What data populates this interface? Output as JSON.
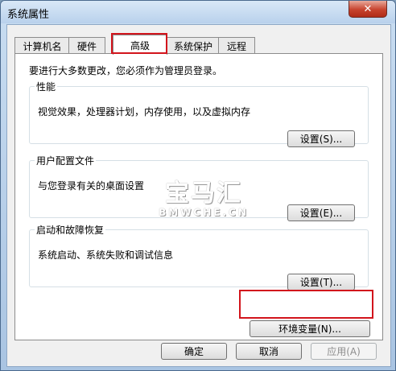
{
  "window": {
    "title": "系统属性",
    "close_glyph": "✕"
  },
  "tabs": [
    {
      "label": "计算机名"
    },
    {
      "label": "硬件"
    },
    {
      "label": "高级"
    },
    {
      "label": "系统保护"
    },
    {
      "label": "远程"
    }
  ],
  "advanced": {
    "admin_note": "要进行大多数更改，您必须作为管理员登录。",
    "performance": {
      "title": "性能",
      "description": "视觉效果，处理器计划，内存使用，以及虚拟内存",
      "button": "设置(S)..."
    },
    "user_profiles": {
      "title": "用户配置文件",
      "description": "与您登录有关的桌面设置",
      "button": "设置(E)..."
    },
    "startup_recovery": {
      "title": "启动和故障恢复",
      "description": "系统启动、系统失败和调试信息",
      "button": "设置(T)..."
    },
    "env_button": "环境变量(N)..."
  },
  "footer": {
    "ok": "确定",
    "cancel": "取消",
    "apply": "应用(A)"
  },
  "watermark": {
    "chinese": "宝马汇",
    "english": "BMWCHE.CN"
  },
  "colors": {
    "highlight": "#d2141c",
    "accent": "#3c7fb1"
  }
}
